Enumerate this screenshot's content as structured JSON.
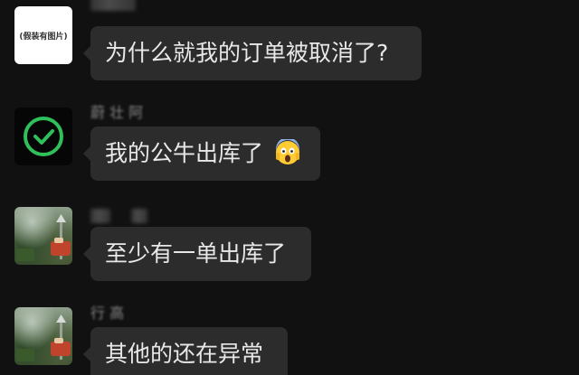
{
  "messages": [
    {
      "sender": "",
      "avatar_label": "(假装有图片)",
      "avatar_icon": "image-placeholder-icon",
      "text": "为什么就我的订单被取消了?"
    },
    {
      "sender": "蔚 壮 阿",
      "avatar_icon": "check-circle-icon",
      "text": "我的公牛出库了",
      "emoji": "face-screaming-in-fear"
    },
    {
      "sender": "",
      "avatar_icon": "landscape-photo-icon",
      "text": "至少有一单出库了"
    },
    {
      "sender": "行 高",
      "avatar_icon": "landscape-photo-icon",
      "text": "其他的还在异常"
    }
  ],
  "colors": {
    "background": "#111111",
    "bubble": "#2c2c2c",
    "text": "#e8e8e8",
    "sender": "#8a8a8a",
    "check_green": "#2fbf5b"
  }
}
